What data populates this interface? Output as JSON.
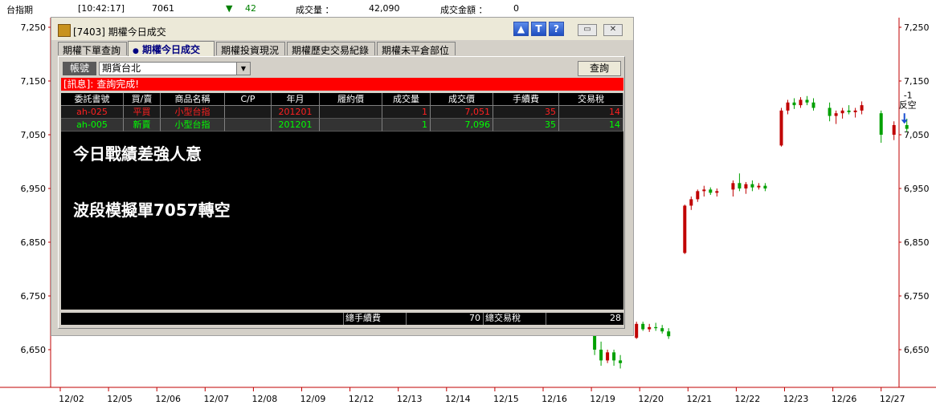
{
  "topbar": {
    "instrument": "台指期",
    "time": "[10:42:17]",
    "price": "7061",
    "change_arrow": "▼",
    "change": "42",
    "volume_label": "成交量 ：",
    "volume": "42,090",
    "amount_label": "成交金額 ：",
    "amount": "0"
  },
  "chart_data": {
    "type": "candlestick",
    "title": "",
    "xlabel": "",
    "ylabel": "",
    "ylim": [
      6590,
      7270
    ],
    "y_ticks": [
      "7,250",
      "7,150",
      "7,050",
      "6,950",
      "6,850",
      "6,750",
      "6,650"
    ],
    "y_tick_values": [
      7250,
      7150,
      7050,
      6950,
      6850,
      6750,
      6650
    ],
    "x_labels": [
      "12/02",
      "12/05",
      "12/06",
      "12/07",
      "12/08",
      "12/09",
      "12/12",
      "12/13",
      "12/14",
      "12/15",
      "12/16",
      "12/19",
      "12/20",
      "12/21",
      "12/22",
      "12/23",
      "12/26",
      "12/27"
    ],
    "sessions": [
      {
        "date": "12/19",
        "bars": [
          [
            6690,
            6700,
            6680,
            6685
          ],
          [
            6680,
            6685,
            6640,
            6650
          ],
          [
            6650,
            6665,
            6620,
            6630
          ],
          [
            6630,
            6650,
            6625,
            6645
          ],
          [
            6645,
            6650,
            6620,
            6630
          ],
          [
            6630,
            6640,
            6615,
            6625
          ]
        ]
      },
      {
        "date": "12/20",
        "bars": [
          [
            6672,
            6702,
            6670,
            6698
          ],
          [
            6698,
            6702,
            6685,
            6688
          ],
          [
            6688,
            6698,
            6683,
            6692
          ],
          [
            6692,
            6700,
            6685,
            6690
          ],
          [
            6690,
            6696,
            6680,
            6684
          ],
          [
            6684,
            6690,
            6670,
            6675
          ]
        ]
      },
      {
        "date": "12/21",
        "bars": [
          [
            6830,
            6920,
            6828,
            6918
          ],
          [
            6918,
            6935,
            6910,
            6930
          ],
          [
            6930,
            6948,
            6925,
            6945
          ],
          [
            6945,
            6955,
            6935,
            6948
          ],
          [
            6948,
            6952,
            6938,
            6942
          ],
          [
            6942,
            6950,
            6935,
            6945
          ]
        ]
      },
      {
        "date": "12/22",
        "bars": [
          [
            6948,
            6965,
            6935,
            6960
          ],
          [
            6960,
            6978,
            6945,
            6950
          ],
          [
            6950,
            6962,
            6940,
            6958
          ],
          [
            6958,
            6965,
            6945,
            6952
          ],
          [
            6952,
            6960,
            6948,
            6955
          ],
          [
            6955,
            6960,
            6945,
            6950
          ]
        ]
      },
      {
        "date": "12/23",
        "bars": [
          [
            7030,
            7100,
            7028,
            7095
          ],
          [
            7095,
            7115,
            7088,
            7110
          ],
          [
            7110,
            7118,
            7098,
            7105
          ],
          [
            7105,
            7120,
            7100,
            7115
          ],
          [
            7115,
            7122,
            7105,
            7110
          ],
          [
            7110,
            7118,
            7095,
            7100
          ]
        ]
      },
      {
        "date": "12/26",
        "bars": [
          [
            7100,
            7110,
            7075,
            7085
          ],
          [
            7085,
            7095,
            7070,
            7090
          ],
          [
            7090,
            7100,
            7080,
            7095
          ],
          [
            7095,
            7105,
            7088,
            7092
          ],
          [
            7092,
            7100,
            7082,
            7095
          ],
          [
            7095,
            7112,
            7088,
            7105
          ]
        ]
      },
      {
        "date": "12/27",
        "bars": [
          [
            7090,
            7095,
            7035,
            7050
          ],
          [
            7050,
            7075,
            7040,
            7068
          ],
          [
            7068,
            7080,
            7055,
            7061
          ]
        ]
      }
    ],
    "annotation": {
      "text1": "-1",
      "text2": "反空"
    },
    "colors": {
      "up": "#c00000",
      "down": "#00a000",
      "axis": "#c00000",
      "grid": "#e0e0e0"
    }
  },
  "window": {
    "title": "[7403] 期權今日成交",
    "buttons": {
      "restore": "▭",
      "close": "✕"
    },
    "tabs": [
      {
        "label": "期權下單查詢"
      },
      {
        "label": "期權今日成交",
        "active": true
      },
      {
        "label": "期權投資現況"
      },
      {
        "label": "期權歷史交易紀錄"
      },
      {
        "label": "期權未平倉部位"
      }
    ],
    "account_label": "帳號",
    "account_value": "期貨台北",
    "query_button": "查詢",
    "message": "[訊息]: 查詢完成!",
    "headers": [
      "委託書號",
      "買/賣",
      "商品名稱",
      "C/P",
      "年月",
      "履約價",
      "成交量",
      "成交價",
      "手續費",
      "交易稅"
    ],
    "rows": [
      [
        "ah-025",
        "平買",
        "小型台指",
        "",
        "201201",
        "",
        "1",
        "7,051",
        "35",
        "14"
      ],
      [
        "ah-005",
        "新賣",
        "小型台指",
        "",
        "201201",
        "",
        "1",
        "7,096",
        "35",
        "14"
      ]
    ],
    "notes": [
      "今日戰績差強人意",
      "波段模擬單7057轉空"
    ],
    "footer": {
      "fee_label": "總手續費",
      "fee_value": "70",
      "tax_label": "總交易稅",
      "tax_value": "28"
    }
  }
}
